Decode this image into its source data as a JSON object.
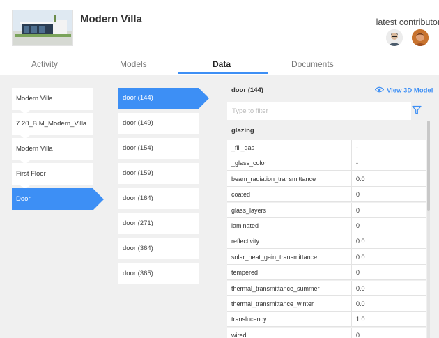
{
  "header": {
    "title": "Modern Villa",
    "contributor_label": "latest contributor"
  },
  "tabs": [
    {
      "label": "Activity"
    },
    {
      "label": "Models"
    },
    {
      "label": "Data"
    },
    {
      "label": "Documents"
    }
  ],
  "hierarchy": [
    {
      "label": "Modern Villa"
    },
    {
      "label": "7.20_BIM_Modern_Villa"
    },
    {
      "label": "Modern Villa"
    },
    {
      "label": "First Floor"
    },
    {
      "label": "Door"
    }
  ],
  "objects": [
    {
      "label": "door (144)"
    },
    {
      "label": "door (149)"
    },
    {
      "label": "door (154)"
    },
    {
      "label": "door (159)"
    },
    {
      "label": "door (164)"
    },
    {
      "label": "door (271)"
    },
    {
      "label": "door (364)"
    },
    {
      "label": "door (365)"
    }
  ],
  "detail": {
    "title": "door (144)",
    "view3d_label": "View 3D Model",
    "filter_placeholder": "Type to filter",
    "group_label": "glazing",
    "rows": [
      {
        "key": "_fill_gas",
        "value": "-"
      },
      {
        "key": "_glass_color",
        "value": "-"
      },
      {
        "key": "beam_radiation_transmittance",
        "value": "0.0"
      },
      {
        "key": "coated",
        "value": "0"
      },
      {
        "key": "glass_layers",
        "value": "0"
      },
      {
        "key": "laminated",
        "value": "0"
      },
      {
        "key": "reflectivity",
        "value": "0.0"
      },
      {
        "key": "solar_heat_gain_transmittance",
        "value": "0.0"
      },
      {
        "key": "tempered",
        "value": "0"
      },
      {
        "key": "thermal_transmittance_summer",
        "value": "0.0"
      },
      {
        "key": "thermal_transmittance_winter",
        "value": "0.0"
      },
      {
        "key": "translucency",
        "value": "1.0"
      },
      {
        "key": "wired",
        "value": "0"
      }
    ]
  },
  "colors": {
    "accent": "#3d8ff5",
    "panel_bg": "#f0f0f0"
  }
}
